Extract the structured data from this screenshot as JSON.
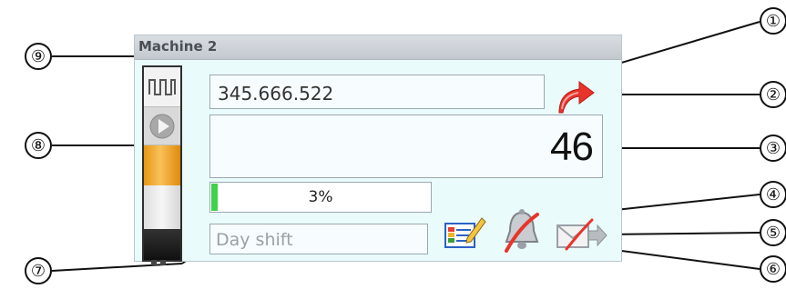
{
  "window": {
    "title": "Machine 2"
  },
  "fields": {
    "counter_value": "345.666.522",
    "main_number": "46",
    "progress_percent": 3,
    "progress_label": "3%",
    "shift_label": "Day shift"
  },
  "stack_light": {
    "segments": [
      "pulse-icon",
      "play-icon",
      "orange-light",
      "grey-light",
      "base"
    ],
    "active_color": "#f0a020"
  },
  "icons": [
    "redo-arrow-icon",
    "edit-note-icon",
    "bell-muted-icon",
    "mail-forward-disabled-icon"
  ],
  "callouts": {
    "c1": "①",
    "c2": "②",
    "c3": "③",
    "c4": "④",
    "c5": "⑤",
    "c6": "⑥",
    "c7": "⑦",
    "c8": "⑧",
    "c9": "⑨"
  },
  "colors": {
    "panel_bg": "#eafbfc",
    "progress_fill": "#3dd24a",
    "arrow_red": "#e8342b"
  }
}
